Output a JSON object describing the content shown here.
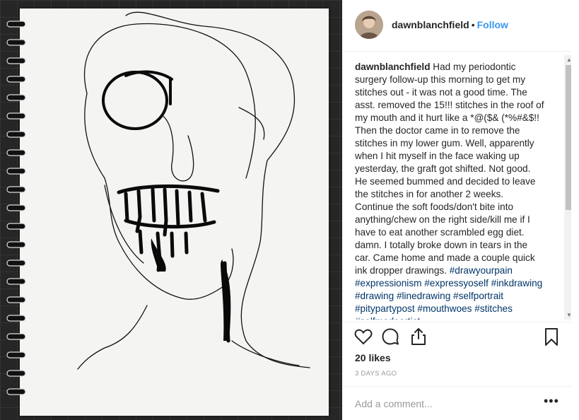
{
  "post": {
    "username": "dawnblanchfield",
    "follow_label": "Follow",
    "caption_user": "dawnblanchfield",
    "caption_text": " Had my periodontic surgery follow-up this morning to get my stitches out - it was not a good time. The asst. removed the 15!!! stitches in the roof of my mouth and it hurt like a *@($& (*%#&$!! Then the doctor came in to remove the stitches in my lower gum. Well, apparently when I hit myself in the face waking up yesterday, the graft got shifted. Not good. He seemed bummed and decided to leave the stitches in for another 2 weeks. Continue the soft foods/don't bite into anything/chew on the right side/kill me if I have to eat another scrambled egg diet. damn. I totally broke down in tears in the car. Came home and made a couple quick ink dropper drawings. ",
    "hashtags": "#drawyourpain #expressionism #expressyoself #inkdrawing #drawing #linedrawing #selfportrait #pitypartypost #mouthwoes #stitches #selfmadeartist",
    "likes": "20 likes",
    "time_ago": "3 DAYS AGO",
    "comment_placeholder": "Add a comment...",
    "more_label": "•••"
  },
  "icons": {
    "like": "heart-icon",
    "comment": "comment-bubble-icon",
    "share": "share-icon",
    "save": "bookmark-icon",
    "more": "more-options-icon"
  },
  "colors": {
    "link": "#3897f0",
    "hashtag": "#003569",
    "text": "#262626",
    "muted": "#999999"
  }
}
